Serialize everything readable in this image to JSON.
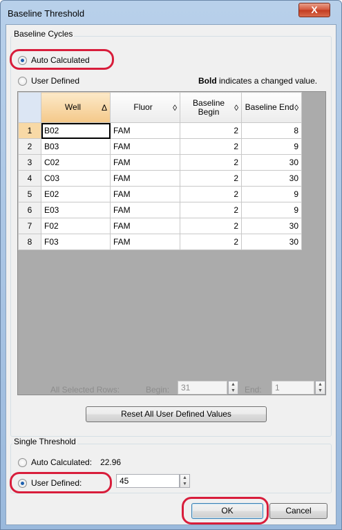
{
  "window": {
    "title": "Baseline Threshold",
    "close_glyph": "X"
  },
  "baseline_cycles": {
    "group_label": "Baseline Cycles",
    "auto_label": "Auto Calculated",
    "user_label": "User Defined",
    "selected": "auto",
    "hint_bold": "Bold",
    "hint_rest": "indicates a changed value."
  },
  "table": {
    "columns": [
      {
        "label": "Well",
        "sort": "Δ"
      },
      {
        "label": "Fluor",
        "sort": "◊"
      },
      {
        "label": "Baseline Begin",
        "sort": "◊"
      },
      {
        "label": "Baseline End",
        "sort": "◊"
      }
    ],
    "rows": [
      {
        "n": "1",
        "well": "B02",
        "fluor": "FAM",
        "begin": "2",
        "end": "8"
      },
      {
        "n": "2",
        "well": "B03",
        "fluor": "FAM",
        "begin": "2",
        "end": "9"
      },
      {
        "n": "3",
        "well": "C02",
        "fluor": "FAM",
        "begin": "2",
        "end": "30"
      },
      {
        "n": "4",
        "well": "C03",
        "fluor": "FAM",
        "begin": "2",
        "end": "30"
      },
      {
        "n": "5",
        "well": "E02",
        "fluor": "FAM",
        "begin": "2",
        "end": "9"
      },
      {
        "n": "6",
        "well": "E03",
        "fluor": "FAM",
        "begin": "2",
        "end": "9"
      },
      {
        "n": "7",
        "well": "F02",
        "fluor": "FAM",
        "begin": "2",
        "end": "30"
      },
      {
        "n": "8",
        "well": "F03",
        "fluor": "FAM",
        "begin": "2",
        "end": "30"
      }
    ]
  },
  "all_selected": {
    "label": "All Selected Rows:",
    "begin_label": "Begin:",
    "begin_value": "31",
    "end_label": "End:",
    "end_value": "1"
  },
  "reset_button": "Reset All User Defined Values",
  "single_threshold": {
    "group_label": "Single Threshold",
    "auto_label": "Auto Calculated:",
    "auto_value": "22.96",
    "user_label": "User Defined:",
    "user_value": "45",
    "selected": "user"
  },
  "buttons": {
    "ok": "OK",
    "cancel": "Cancel"
  },
  "colors": {
    "highlight": "#d81d3b",
    "title_bar": "#a6c2e2"
  }
}
